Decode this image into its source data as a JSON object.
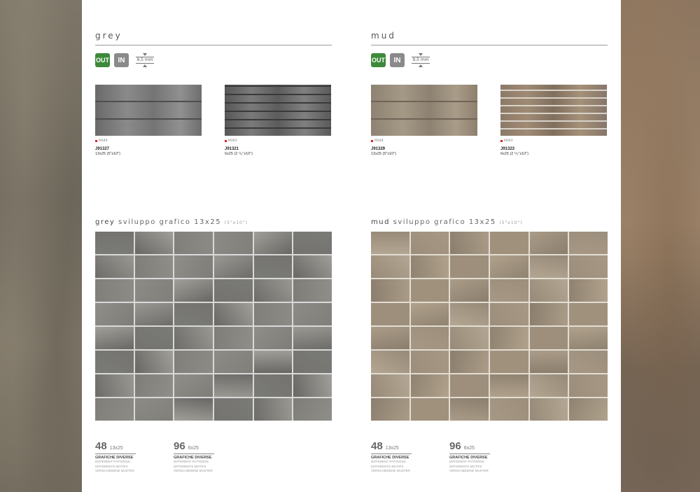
{
  "columns": [
    {
      "title": "grey",
      "badges": {
        "out": "OUT",
        "in": "IN",
        "thickness": "9,5 mm"
      },
      "products": [
        {
          "swatch_code": "M349",
          "code": "J91327",
          "size": "13x25 (5\"x10\")"
        },
        {
          "swatch_code": "M393",
          "code": "J91321",
          "size": "6x25 (2 ¹/₂\"x10\")"
        }
      ],
      "sub_title_first": "grey",
      "sub_title_rest": "sviluppo grafico 13x25",
      "sub_title_inch": "(5\"x10\")",
      "mosaic_palette": [
        "#7a7a76",
        "#8c8b86",
        "#6d6c68",
        "#9a9893",
        "#807f7a",
        "#747370",
        "#8f8e89",
        "#686764",
        "#a19f99",
        "#7e7d78"
      ],
      "counts": [
        {
          "number": "48",
          "size": "13x25",
          "label": "GRAFICHE DIVERSE",
          "sub": [
            "DIFFERENT PATTERNS",
            "DIFFERENTS MOTIFS",
            "VERSCHIEDENE MUSTER"
          ]
        },
        {
          "number": "96",
          "size": "6x25",
          "label": "GRAFICHE DIVERSE",
          "sub": [
            "DIFFERENT PATTERNS",
            "DIFFERENTS MOTIFS",
            "VERSCHIEDENE MUSTER"
          ]
        }
      ]
    },
    {
      "title": "mud",
      "badges": {
        "out": "OUT",
        "in": "IN",
        "thickness": "9,5 mm"
      },
      "products": [
        {
          "swatch_code": "M349",
          "code": "J91329",
          "size": "13x25 (5\"x10\")"
        },
        {
          "swatch_code": "M393",
          "code": "J91323",
          "size": "6x25 (2 ¹/₂\"x10\")"
        }
      ],
      "sub_title_first": "mud",
      "sub_title_rest": "sviluppo grafico 13x25",
      "sub_title_inch": "(5\"x10\")",
      "mosaic_palette": [
        "#9c8e7c",
        "#aa9c88",
        "#8f8270",
        "#b3a692",
        "#a0917d",
        "#978a78",
        "#b0a28c",
        "#8b7e6d",
        "#a69883",
        "#9d8f7b"
      ],
      "counts": [
        {
          "number": "48",
          "size": "13x25",
          "label": "GRAFICHE DIVERSE",
          "sub": [
            "DIFFERENT PATTERNS",
            "DIFFERENTS MOTIFS",
            "VERSCHIEDENE MUSTER"
          ]
        },
        {
          "number": "96",
          "size": "6x25",
          "label": "GRAFICHE DIVERSE",
          "sub": [
            "DIFFERENT PATTERNS",
            "DIFFERENTS MOTIFS",
            "VERSCHIEDENE MUSTER"
          ]
        }
      ]
    }
  ]
}
